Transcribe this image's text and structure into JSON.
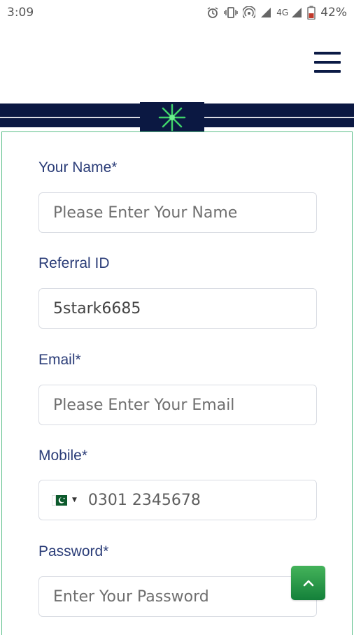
{
  "status_bar": {
    "time": "3:09",
    "network": "4G",
    "battery": "42%"
  },
  "colors": {
    "navy": "#0b1842",
    "label": "#2b3d78",
    "card_border": "#5cc08a",
    "accent_green": "#1f9a45"
  },
  "form": {
    "name": {
      "label": "Your Name*",
      "placeholder": "Please Enter Your Name"
    },
    "referral": {
      "label": "Referral ID",
      "value": "5stark6685"
    },
    "email": {
      "label": "Email*",
      "placeholder": "Please Enter Your Email"
    },
    "mobile": {
      "label": "Mobile*",
      "placeholder": "0301 2345678",
      "country_icon": "pakistan-flag-icon"
    },
    "password": {
      "label": "Password*",
      "placeholder": "Enter Your Password"
    }
  },
  "icons": {
    "menu": "hamburger-menu-icon",
    "emblem": "star-burst-icon",
    "scroll_top": "chevron-up-icon"
  }
}
